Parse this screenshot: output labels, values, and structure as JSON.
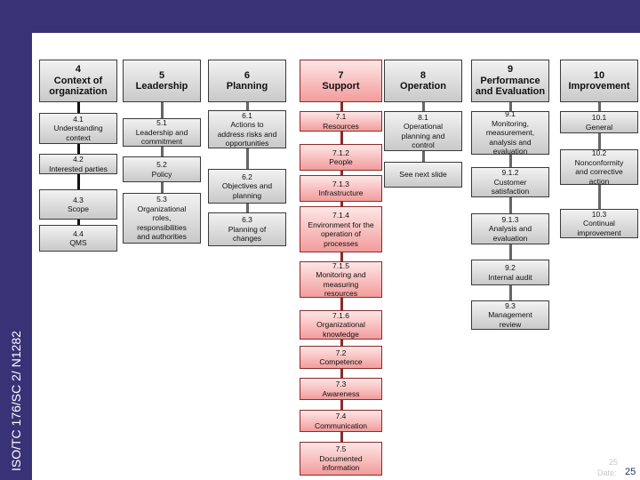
{
  "sidebar": {
    "doc_ref": "ISO/TC 176/SC 2/ N1282"
  },
  "diagram": {
    "columns": [
      {
        "id": "4",
        "heading": "4\nContext of\norganization",
        "color": "gray",
        "items": [
          "4.1\nUnderstanding\ncontext",
          "4.2\nInterested parties",
          "4.3\nScope",
          "4.4\nQMS"
        ]
      },
      {
        "id": "5",
        "heading": "5\nLeadership",
        "color": "gray",
        "items": [
          "5.1\nLeadership and\ncommitment",
          "5.2\nPolicy",
          "5.3\nOrganizational\nroles,\nresponsibilities\nand authorities"
        ]
      },
      {
        "id": "6",
        "heading": "6\nPlanning",
        "color": "gray",
        "items": [
          "6.1\nActions to\naddress risks and\nopportunities",
          "6.2\nObjectives and\nplanning",
          "6.3\nPlanning of\nchanges"
        ]
      },
      {
        "id": "7",
        "heading": "7\nSupport",
        "color": "red",
        "items": [
          "7.1\nResources",
          "7.1.2\nPeople",
          "7.1.3\nInfrastructure",
          "7.1.4\nEnvironment for the\noperation of\nprocesses",
          "7.1.5\nMonitoring and\nmeasuring\nresources",
          "7.1.6\nOrganizational\nknowledge",
          "7.2\nCompetence",
          "7.3\nAwareness",
          "7.4\nCommunication",
          "7.5\nDocumented\ninformation"
        ]
      },
      {
        "id": "8",
        "heading": "8\nOperation",
        "color": "gray",
        "items": [
          "8.1\nOperational\nplanning and\ncontrol",
          "See next slide"
        ]
      },
      {
        "id": "9",
        "heading": "9\nPerformance\nand Evaluation",
        "color": "gray",
        "items": [
          "9.1\nMonitoring,\nmeasurement,\nanalysis and\nevaluation",
          "9.1.2\nCustomer\nsatisfaction",
          "9.1.3\nAnalysis and\nevaluation",
          "9.2\nInternal audit",
          "9.3\nManagement\nreview"
        ]
      },
      {
        "id": "10",
        "heading": "10\nImprovement",
        "color": "gray",
        "items": [
          "10.1\nGeneral",
          "10.2\nNonconformity\nand corrective\naction",
          "10.3\nContinual\nimprovement"
        ]
      }
    ]
  },
  "footer": {
    "slide_num_faint": "25",
    "date_label": "Date:",
    "page_number": "25"
  },
  "colors": {
    "frame": "#3a3276",
    "support_border": "#8a2b2b",
    "support_fill": "#f7b5b5",
    "gray_fill": "#d9d9d9"
  }
}
